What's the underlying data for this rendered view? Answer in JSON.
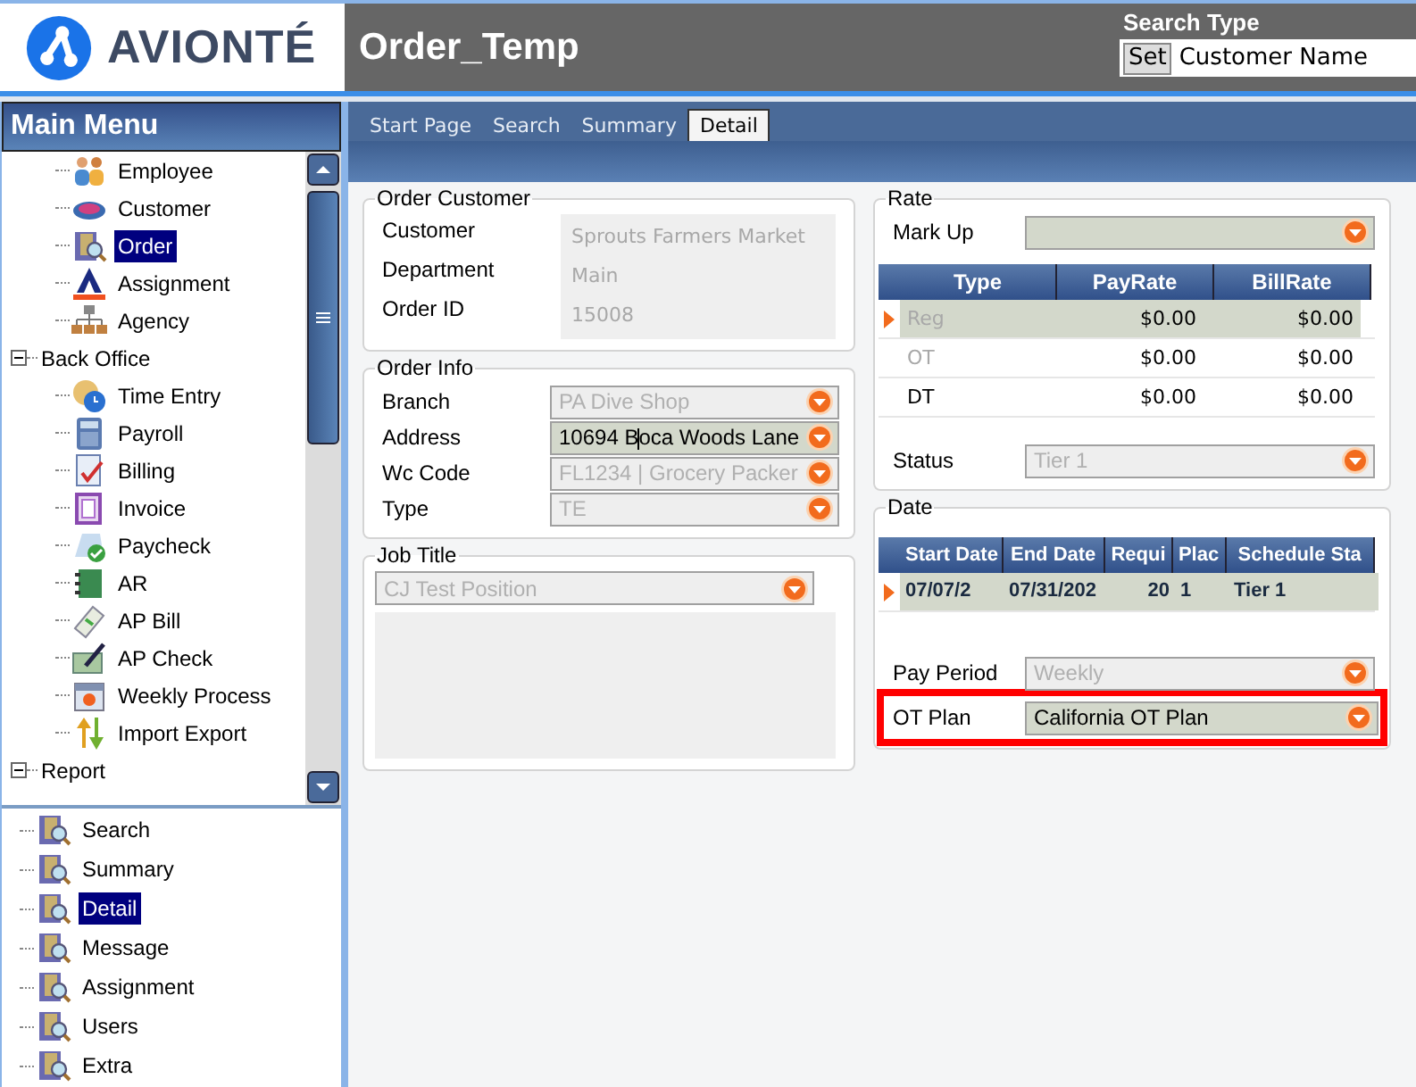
{
  "logo": {
    "text": "AVIONTÉ"
  },
  "window": {
    "title": "Order_Temp"
  },
  "search_type": {
    "label": "Search Type",
    "button": "Set",
    "value": "Customer Name"
  },
  "main_menu": {
    "title": "Main Menu",
    "tree": [
      {
        "children": [
          {
            "label": "Employee",
            "selected": false
          },
          {
            "label": "Customer",
            "selected": false
          },
          {
            "label": "Order",
            "selected": true
          },
          {
            "label": "Assignment",
            "selected": false
          },
          {
            "label": "Agency",
            "selected": false
          }
        ]
      },
      {
        "label": "Back Office",
        "expanded": true,
        "children": [
          {
            "label": "Time Entry",
            "selected": false
          },
          {
            "label": "Payroll",
            "selected": false
          },
          {
            "label": "Billing",
            "selected": false
          },
          {
            "label": "Invoice",
            "selected": false
          },
          {
            "label": "Paycheck",
            "selected": false
          },
          {
            "label": "AR",
            "selected": false
          },
          {
            "label": "AP Bill",
            "selected": false
          },
          {
            "label": "AP Check",
            "selected": false
          },
          {
            "label": "Weekly Process",
            "selected": false
          },
          {
            "label": "Import Export",
            "selected": false
          }
        ]
      },
      {
        "label": "Report",
        "expanded": true
      }
    ]
  },
  "report_items": [
    {
      "label": "Search",
      "selected": false
    },
    {
      "label": "Summary",
      "selected": false
    },
    {
      "label": "Detail",
      "selected": true
    },
    {
      "label": "Message",
      "selected": false
    },
    {
      "label": "Assignment",
      "selected": false
    },
    {
      "label": "Users",
      "selected": false
    },
    {
      "label": "Extra",
      "selected": false
    }
  ],
  "tabs": [
    {
      "label": "Start Page",
      "selected": false
    },
    {
      "label": "Search",
      "selected": false
    },
    {
      "label": "Summary",
      "selected": false
    },
    {
      "label": "Detail",
      "selected": true
    }
  ],
  "order_customer": {
    "title": "Order Customer",
    "fields": [
      {
        "label": "Customer",
        "value": "Sprouts Farmers Market"
      },
      {
        "label": "Department",
        "value": "Main"
      },
      {
        "label": "Order ID",
        "value": "15008"
      }
    ]
  },
  "order_info": {
    "title": "Order Info",
    "fields": [
      {
        "label": "Branch",
        "value": "PA Dive Shop",
        "disabled": true,
        "focused": false
      },
      {
        "label": "Address",
        "value": "10694 Boca Woods Lane",
        "disabled": false,
        "focused": true
      },
      {
        "label": "Wc Code",
        "value": "FL1234    |    Grocery Packer",
        "disabled": true,
        "focused": false
      },
      {
        "label": "Type",
        "value": "TE",
        "disabled": true,
        "focused": false
      }
    ]
  },
  "job_title": {
    "title": "Job Title",
    "value": "CJ Test Position",
    "disabled": true
  },
  "rate": {
    "title": "Rate",
    "mark_up": {
      "label": "Mark Up",
      "disabled": false
    },
    "grid": {
      "columns": [
        "Type",
        "PayRate",
        "BillRate"
      ],
      "rows": [
        {
          "cells": [
            "Reg",
            "$0.00",
            "$0.00"
          ],
          "selected": true,
          "dimmed": true
        },
        {
          "cells": [
            "OT",
            "$0.00",
            "$0.00"
          ],
          "selected": false,
          "dimmed": true
        },
        {
          "cells": [
            "DT",
            "$0.00",
            "$0.00"
          ],
          "selected": false,
          "dimmed": false
        }
      ]
    },
    "status": {
      "label": "Status",
      "value": "Tier 1",
      "disabled": true
    }
  },
  "date": {
    "title": "Date",
    "grid": {
      "columns": [
        "Start Date",
        "End Date",
        "Requi",
        "Plac",
        "Schedule Sta"
      ],
      "rows": [
        {
          "cells": [
            "07/07/2",
            "07/31/202",
            "20",
            "1",
            "Tier 1"
          ],
          "selected": true
        }
      ]
    },
    "pay_period": {
      "label": "Pay Period",
      "value": "Weekly",
      "disabled": true,
      "highlighted": false
    },
    "ot_plan": {
      "label": "OT Plan",
      "value": "California OT Plan",
      "disabled": false,
      "highlighted": true
    }
  }
}
